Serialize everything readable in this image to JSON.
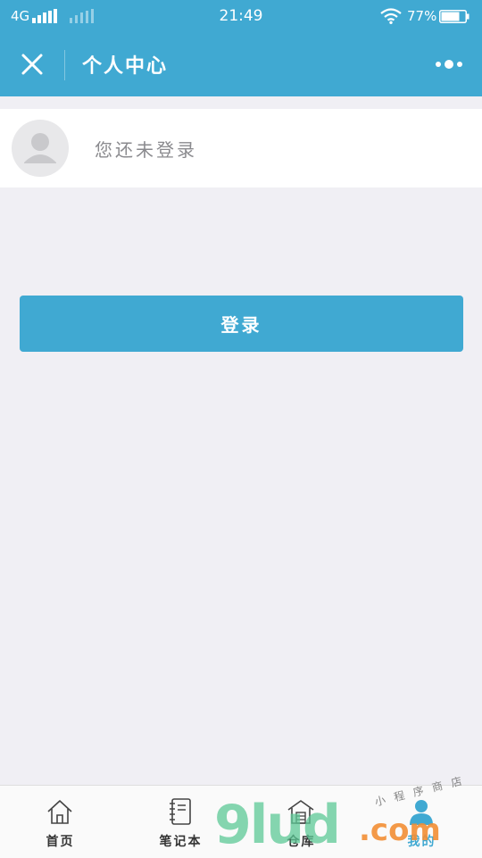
{
  "status_bar": {
    "network": "4G",
    "time": "21:49",
    "battery": "77%",
    "battery_level": 0.77
  },
  "header": {
    "title": "个人中心",
    "close_icon": "close-icon",
    "more_icon": "more-options-icon"
  },
  "profile": {
    "status_text": "您还未登录",
    "avatar_icon": "default-avatar-icon"
  },
  "login_button": {
    "label": "登录"
  },
  "tabbar": {
    "items": [
      {
        "label": "首页",
        "icon": "home-icon",
        "active": false
      },
      {
        "label": "笔记本",
        "icon": "notebook-icon",
        "active": false
      },
      {
        "label": "仓库",
        "icon": "warehouse-icon",
        "active": false
      },
      {
        "label": "我的",
        "icon": "user-icon",
        "active": true
      }
    ]
  },
  "watermark": {
    "brand": "9lud",
    "suffix": ".com",
    "tagline": "小程序商店"
  },
  "colors": {
    "primary": "#40a9d2",
    "background": "#f0eff4",
    "card": "#ffffff",
    "muted_text": "#8a8a8e"
  }
}
